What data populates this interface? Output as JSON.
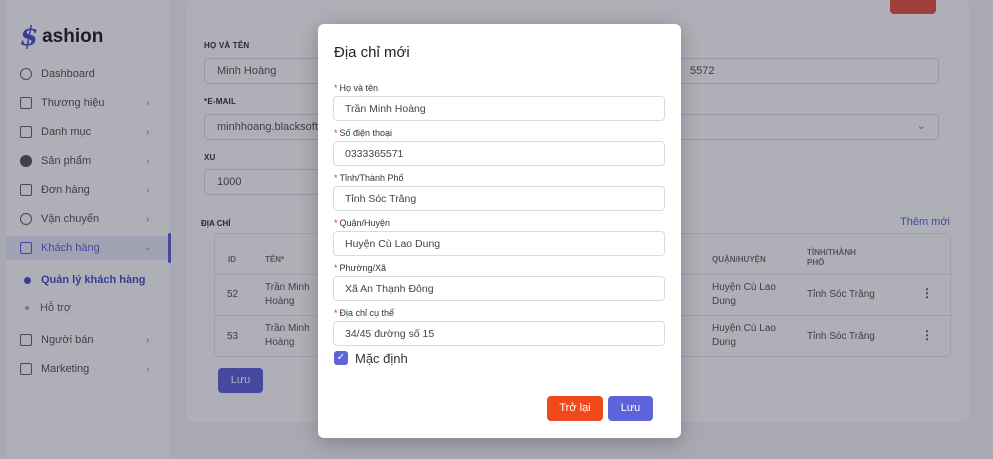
{
  "brand": {
    "logo_mark": "$",
    "logo_text": "ashion"
  },
  "sidebar": {
    "items": [
      {
        "label": "Dashboard",
        "chevron": ""
      },
      {
        "label": "Thương hiệu",
        "chevron": "›"
      },
      {
        "label": "Danh mục",
        "chevron": "›"
      },
      {
        "label": "Sản phẩm",
        "chevron": "›"
      },
      {
        "label": "Đơn hàng",
        "chevron": "›"
      },
      {
        "label": "Vận chuyển",
        "chevron": "›"
      },
      {
        "label": "Khách hàng",
        "chevron": "›"
      },
      {
        "label": "Người bán",
        "chevron": "›"
      },
      {
        "label": "Marketing",
        "chevron": "›"
      }
    ],
    "sub_items": [
      {
        "label": "Quản lý khách hàng"
      },
      {
        "label": "Hỗ trợ"
      }
    ]
  },
  "form": {
    "name_label": "HỌ VÀ TÊN",
    "name_value": "Minh Hoàng",
    "phone_value": "5572",
    "email_label": "*E-MAIL",
    "email_value": "minhhoang.blacksoft",
    "xu_label": "XU",
    "xu_value": "1000",
    "select_chevron": "⌄"
  },
  "address": {
    "title": "ĐỊA CHỈ",
    "add_new": "Thêm mới",
    "headers": {
      "id": "ID",
      "name": "TÊN*",
      "district": "QUẬN/HUYỆN",
      "province_line1": "TỈNH/THÀNH",
      "province_line2": "PHỐ"
    },
    "rows": [
      {
        "id": "52",
        "name1": "Trần Minh",
        "name2": "Hoàng",
        "district1": "Huyện Cù Lao",
        "district2": "Dung",
        "province": "Tỉnh Sóc Trăng"
      },
      {
        "id": "53",
        "name1": "Trần Minh",
        "name2": "Hoàng",
        "district1": "Huyện Cù Lao",
        "district2": "Dung",
        "province": "Tỉnh Sóc Trăng"
      }
    ],
    "kebab": "⋮",
    "save_label": "Lưu"
  },
  "modal": {
    "title": "Địa chỉ mới",
    "fields": [
      {
        "req": "*",
        "label": "Họ và tên",
        "value": "Trần Minh Hoàng"
      },
      {
        "req": "*",
        "label": "Số điện thoại",
        "value": "0333365571"
      },
      {
        "req": "*",
        "label": "Tỉnh/Thành Phố",
        "value": "Tỉnh Sóc Trăng"
      },
      {
        "req": "*",
        "label": "Quận/Huyện",
        "value": "Huyện Cù Lao Dung"
      },
      {
        "req": "*",
        "label": "Phường/Xã",
        "value": "Xã An Thạnh Đông"
      },
      {
        "req": "*",
        "label": "Địa chỉ cụ thể",
        "value": "34/45 đường số 15"
      }
    ],
    "default_label": "Mặc định",
    "checkmark": "✓",
    "back_label": "Trở lại",
    "save_label": "Lưu"
  }
}
